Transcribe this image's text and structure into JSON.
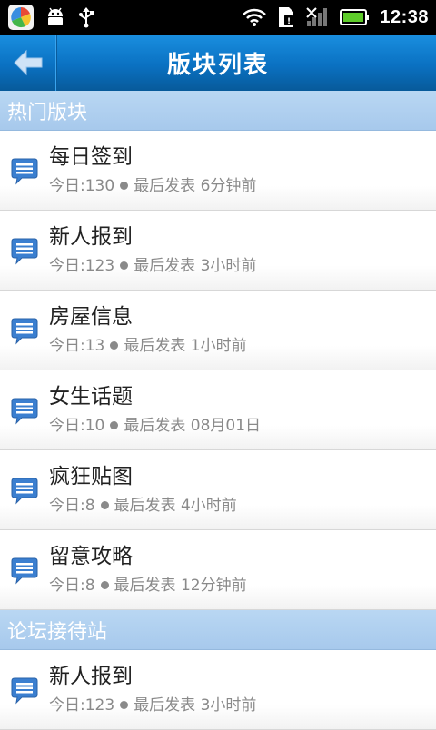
{
  "status_bar": {
    "time": "12:38",
    "icons": [
      "app-icon",
      "android-debug-icon",
      "usb-icon",
      "wifi-icon",
      "sim-icon",
      "signal-icon",
      "battery-icon"
    ]
  },
  "header": {
    "title": "版块列表",
    "back_icon": "back-arrow-icon"
  },
  "sections": [
    {
      "title": "热门版块",
      "items": [
        {
          "name": "每日签到",
          "today": "今日:130",
          "last": "最后发表 6分钟前"
        },
        {
          "name": "新人报到",
          "today": "今日:123",
          "last": "最后发表 3小时前"
        },
        {
          "name": "房屋信息",
          "today": "今日:13",
          "last": "最后发表 1小时前"
        },
        {
          "name": "女生话题",
          "today": "今日:10",
          "last": "最后发表 08月01日"
        },
        {
          "name": "疯狂贴图",
          "today": "今日:8",
          "last": "最后发表 4小时前"
        },
        {
          "name": "留意攻略",
          "today": "今日:8",
          "last": "最后发表 12分钟前"
        }
      ]
    },
    {
      "title": "论坛接待站",
      "items": [
        {
          "name": "新人报到",
          "today": "今日:123",
          "last": "最后发表 3小时前"
        }
      ]
    }
  ],
  "colors": {
    "title_bar": "#0a71c2",
    "section_header": "#a7c9ec",
    "subtext": "#8a8a8a"
  }
}
